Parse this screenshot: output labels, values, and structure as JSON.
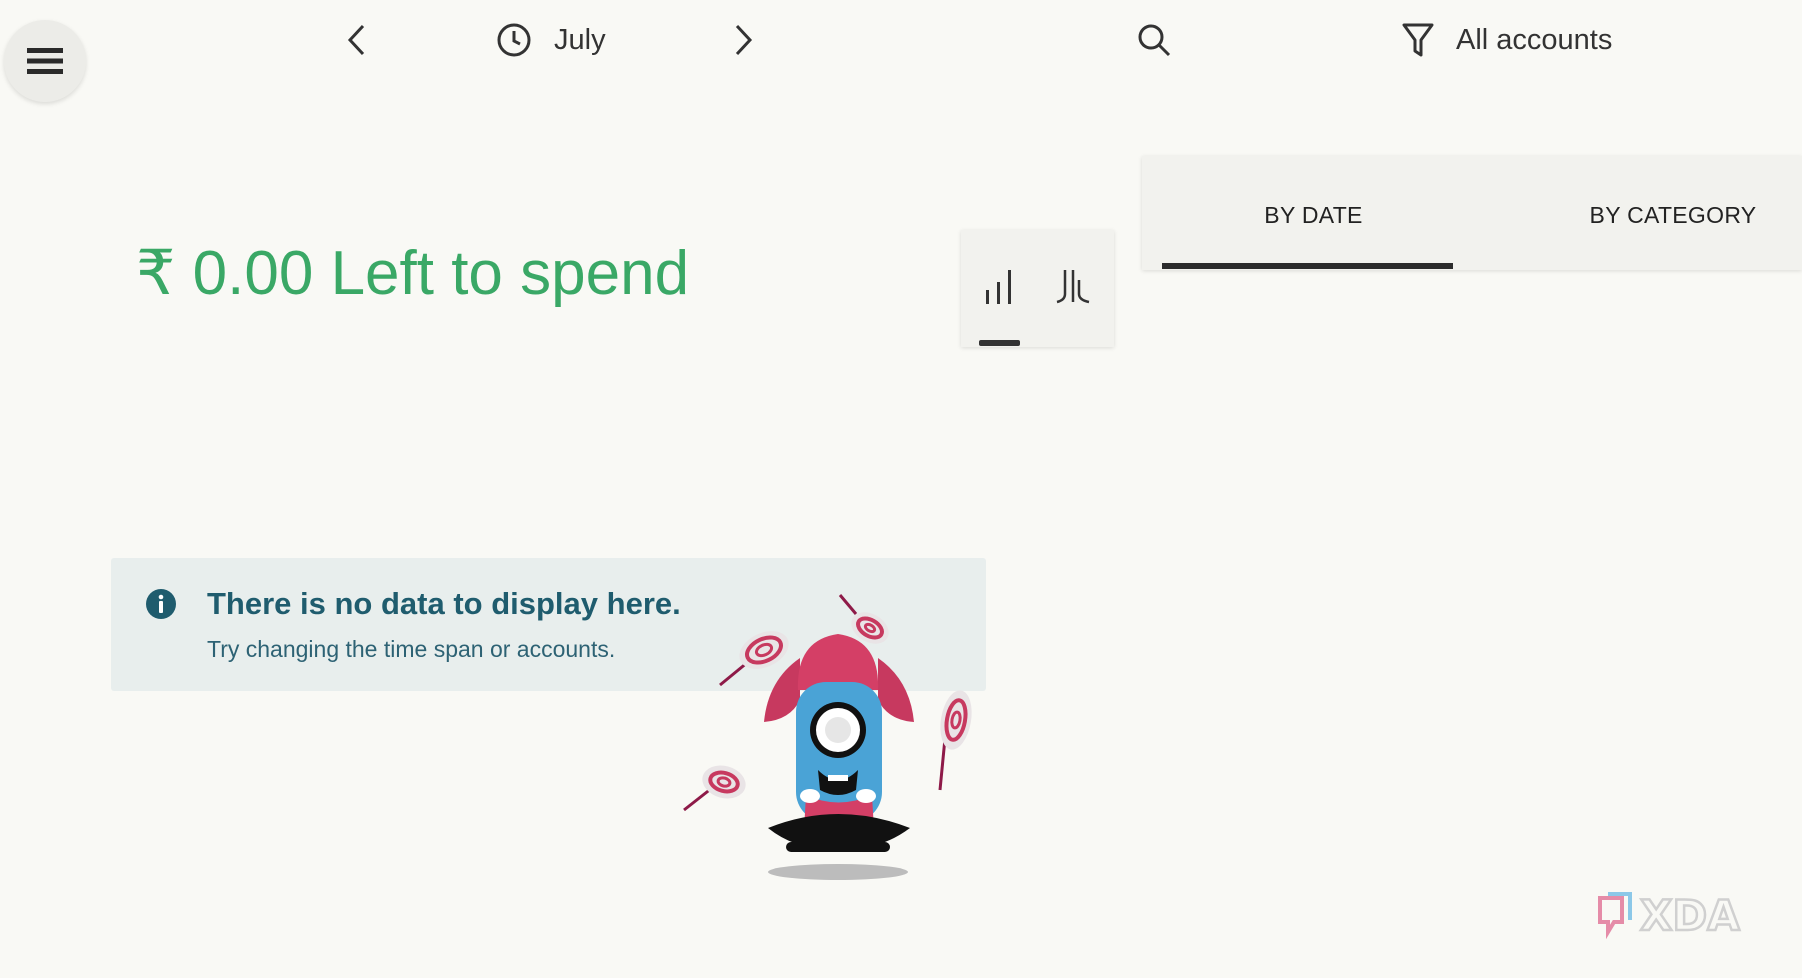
{
  "header": {
    "menu_icon": "hamburger-menu-icon",
    "prev_icon": "chevron-left-icon",
    "clock_icon": "clock-icon",
    "month": "July",
    "next_icon": "chevron-right-icon",
    "search_icon": "search-icon",
    "filter_icon": "filter-icon",
    "accounts": "All accounts"
  },
  "summary": {
    "left_to_spend": "₹ 0.00 Left to spend",
    "color": "#3aa866"
  },
  "chart_toggle": {
    "options": [
      "bar-chart-icon",
      "split-chart-icon"
    ],
    "selected": "bar-chart-icon"
  },
  "tabs": {
    "by_date": "BY DATE",
    "by_category": "BY CATEGORY",
    "active": "BY DATE"
  },
  "empty_state": {
    "icon": "info-icon",
    "title": "There is no data to display here.",
    "subtitle": "Try changing the time span or accounts.",
    "illustration": "mascot-juggling-lollipops"
  },
  "watermark": "XDA"
}
